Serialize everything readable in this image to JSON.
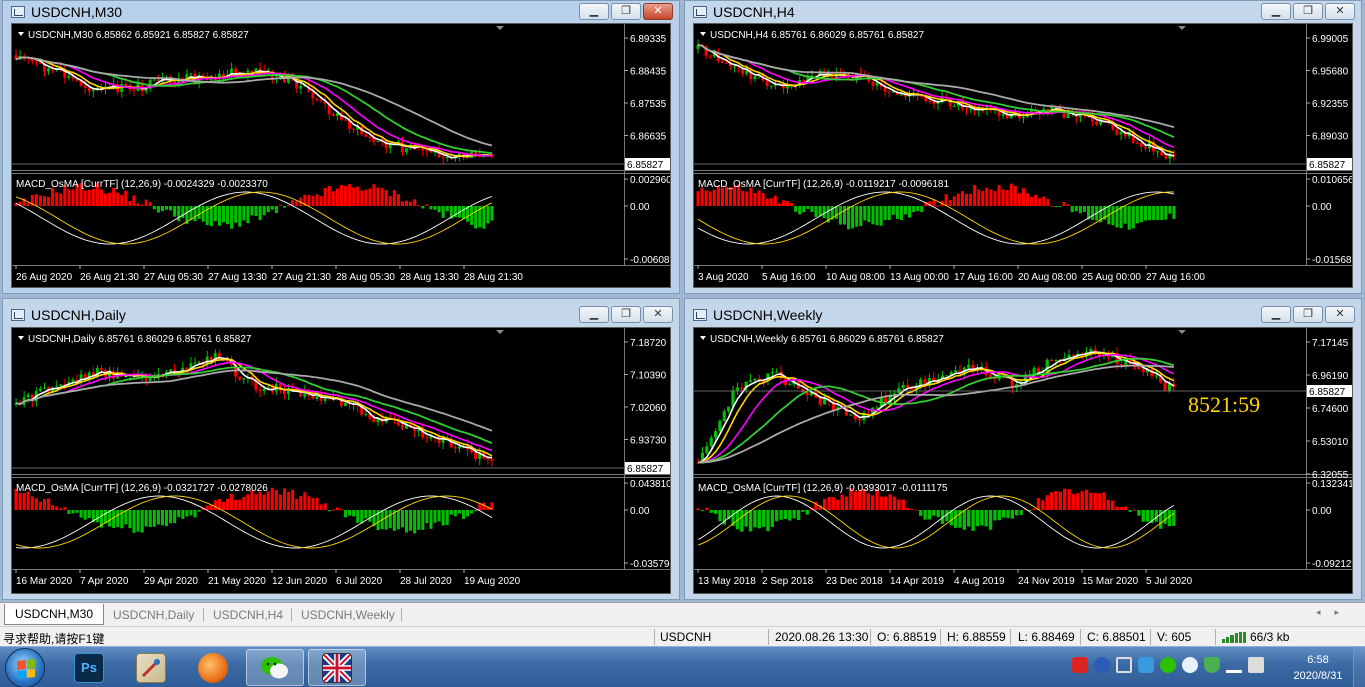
{
  "colors": {
    "up_candle": "#00c000",
    "down_candle": "#ff0000",
    "ma_white": "#ffffff",
    "ma_yellow": "#ffd700",
    "ma_magenta": "#ff00ff",
    "ma_green": "#32cd32",
    "ma_gray": "#a9a9a9",
    "timer": "#ffd700"
  },
  "windows": [
    {
      "id": "m30",
      "title": "USDCNH,M30",
      "active": true,
      "header": "USDCNH,M30  6.85862 6.85921 6.85827 6.85827",
      "price_ticks": [
        "6.89335",
        "6.88435",
        "6.87535",
        "6.86635"
      ],
      "price_last": "6.85827",
      "indicator_header": "MACD_OsMA [CurrTF] (12,26,9) -0.0024329 -0.0023370",
      "ind_ticks": [
        "0.0029604",
        "0.00",
        "-0.006089"
      ],
      "time_ticks": [
        "26 Aug 2020",
        "26 Aug 21:30",
        "27 Aug 05:30",
        "27 Aug 13:30",
        "27 Aug 21:30",
        "28 Aug 05:30",
        "28 Aug 13:30",
        "28 Aug 21:30"
      ],
      "timer": ""
    },
    {
      "id": "h4",
      "title": "USDCNH,H4",
      "active": false,
      "header": "USDCNH,H4  6.85761 6.86029 6.85761 6.85827",
      "price_ticks": [
        "6.99005",
        "6.95680",
        "6.92355",
        "6.89030"
      ],
      "price_last": "6.85827",
      "indicator_header": "MACD_OsMA [CurrTF] (12,26,9) -0.0119217 -0.0096181",
      "ind_ticks": [
        "0.0106564",
        "0.00",
        "-0.015688"
      ],
      "time_ticks": [
        "3 Aug 2020",
        "5 Aug 16:00",
        "10 Aug 08:00",
        "13 Aug 00:00",
        "17 Aug 16:00",
        "20 Aug 08:00",
        "25 Aug 00:00",
        "27 Aug 16:00"
      ],
      "timer": ""
    },
    {
      "id": "d1",
      "title": "USDCNH,Daily",
      "active": false,
      "header": "USDCNH,Daily  6.85761 6.86029 6.85761 6.85827",
      "price_ticks": [
        "7.18720",
        "7.10390",
        "7.02060",
        "6.93730"
      ],
      "price_last": "6.85827",
      "indicator_header": "MACD_OsMA [CurrTF] (12,26,9) -0.0321727 -0.0278026",
      "ind_ticks": [
        "0.0438105",
        "0.00",
        "-0.035791"
      ],
      "time_ticks": [
        "16 Mar 2020",
        "7 Apr 2020",
        "29 Apr 2020",
        "21 May 2020",
        "12 Jun 2020",
        "6 Jul 2020",
        "28 Jul 2020",
        "19 Aug 2020"
      ],
      "timer": ""
    },
    {
      "id": "w1",
      "title": "USDCNH,Weekly",
      "active": false,
      "header": "USDCNH,Weekly  6.85761 6.86029 6.85761 6.85827",
      "price_ticks": [
        "7.17145",
        "6.96190",
        "6.74600",
        "6.53010",
        "6.32055"
      ],
      "price_last": "6.85827",
      "indicator_header": "MACD_OsMA [CurrTF] (12,26,9) -0.0393017 -0.0111175",
      "ind_ticks": [
        "0.1323419",
        "0.00",
        "-0.092128"
      ],
      "time_ticks": [
        "13 May 2018",
        "2 Sep 2018",
        "23 Dec 2018",
        "14 Apr 2019",
        "4 Aug 2019",
        "24 Nov 2019",
        "15 Mar 2020",
        "5 Jul 2020"
      ],
      "timer": "8521:59"
    }
  ],
  "tabs": [
    "USDCNH,M30",
    "USDCNH,Daily",
    "USDCNH,H4",
    "USDCNH,Weekly"
  ],
  "active_tab": 0,
  "status": {
    "help": "寻求帮助,请按F1键",
    "symbol": "USDCNH",
    "datetime": "2020.08.26 13:30",
    "open": "O: 6.88519",
    "high": "H: 6.88559",
    "low": "L: 6.88469",
    "close": "C: 6.88501",
    "volume": "V: 605",
    "traffic": "66/3 kb"
  },
  "taskbar": {
    "apps": [
      "start-button",
      "photoshop",
      "image-viewer",
      "firefox",
      "wechat",
      "mt4-uk-flag"
    ],
    "ps_label": "Ps",
    "clock_time": "6:58",
    "clock_date": "2020/8/31"
  }
}
